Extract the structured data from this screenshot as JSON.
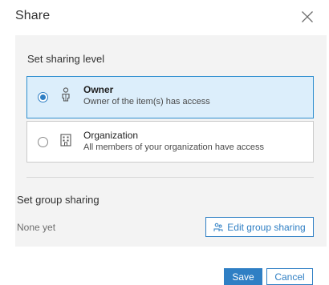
{
  "dialog": {
    "title": "Share",
    "close_icon": "close-icon"
  },
  "sharing_level": {
    "label": "Set sharing level",
    "options": [
      {
        "title": "Owner",
        "description": "Owner of the item(s) has access",
        "icon": "person-icon",
        "selected": true
      },
      {
        "title": "Organization",
        "description": "All members of your organization have access",
        "icon": "organization-building-icon",
        "selected": false
      }
    ]
  },
  "group_sharing": {
    "label": "Set group sharing",
    "status": "None yet",
    "edit_button_label": "Edit group sharing",
    "edit_button_icon": "group-icon"
  },
  "footer": {
    "save_label": "Save",
    "cancel_label": "Cancel"
  },
  "colors": {
    "accent": "#2f7fc4",
    "selected_bg": "#dceefb",
    "panel_bg": "#f3f3f3"
  }
}
